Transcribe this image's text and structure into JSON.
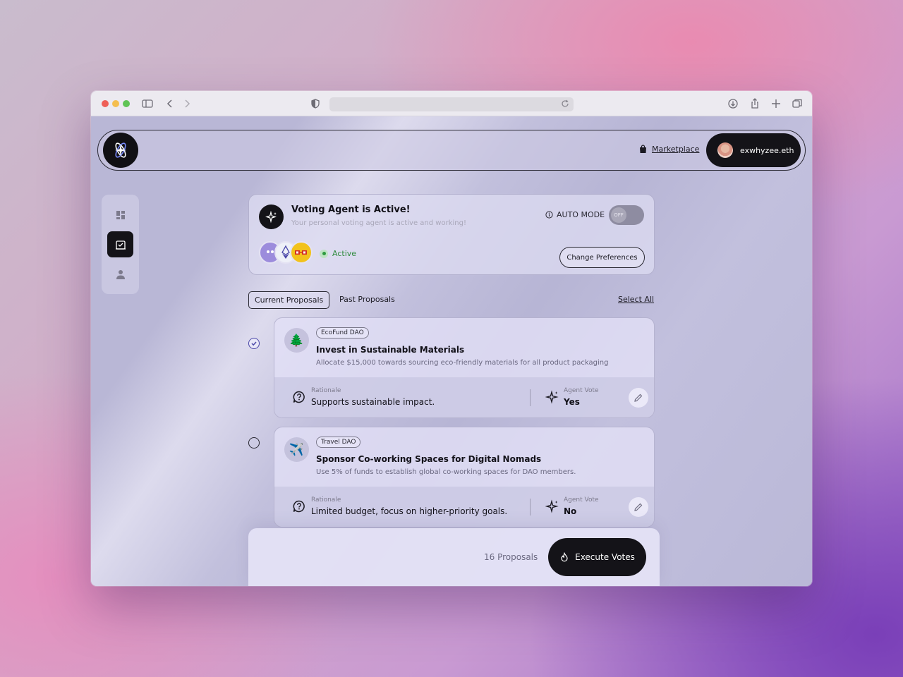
{
  "header": {
    "marketplace_label": "Marketplace",
    "username": "exwhyzee.eth"
  },
  "agent": {
    "title": "Voting Agent is Active!",
    "subtitle": "Your personal voting agent is active and working!",
    "auto_mode_label": "AUTO MODE",
    "toggle_state": "OFF",
    "status": "Active",
    "change_preferences_label": "Change Preferences"
  },
  "tabs": {
    "current": "Current Proposals",
    "past": "Past Proposals",
    "select_all": "Select All"
  },
  "proposals": [
    {
      "dao": "EcoFund DAO",
      "icon": "tree-icon",
      "emoji": "🌲",
      "title": "Invest in Sustainable Materials",
      "description": "Allocate $15,000 towards sourcing eco-friendly materials for all product packaging",
      "rationale_label": "Rationale",
      "rationale": "Supports sustainable impact.",
      "vote_label": "Agent Vote",
      "vote": "Yes",
      "checked": true
    },
    {
      "dao": "Travel DAO",
      "icon": "airplane-icon",
      "emoji": "✈️",
      "title": "Sponsor Co-working Spaces for Digital Nomads",
      "description": "Use 5% of funds to establish global co-working spaces for DAO members.",
      "rationale_label": "Rationale",
      "rationale": "Limited budget, focus on higher-priority goals.",
      "vote_label": "Agent Vote",
      "vote": "No",
      "checked": false
    }
  ],
  "footer": {
    "count": "16 Proposals",
    "execute_label": "Execute Votes"
  },
  "colors": {
    "dark": "#141318",
    "accent": "#4a46a8",
    "active_green": "#2e8a3c"
  }
}
